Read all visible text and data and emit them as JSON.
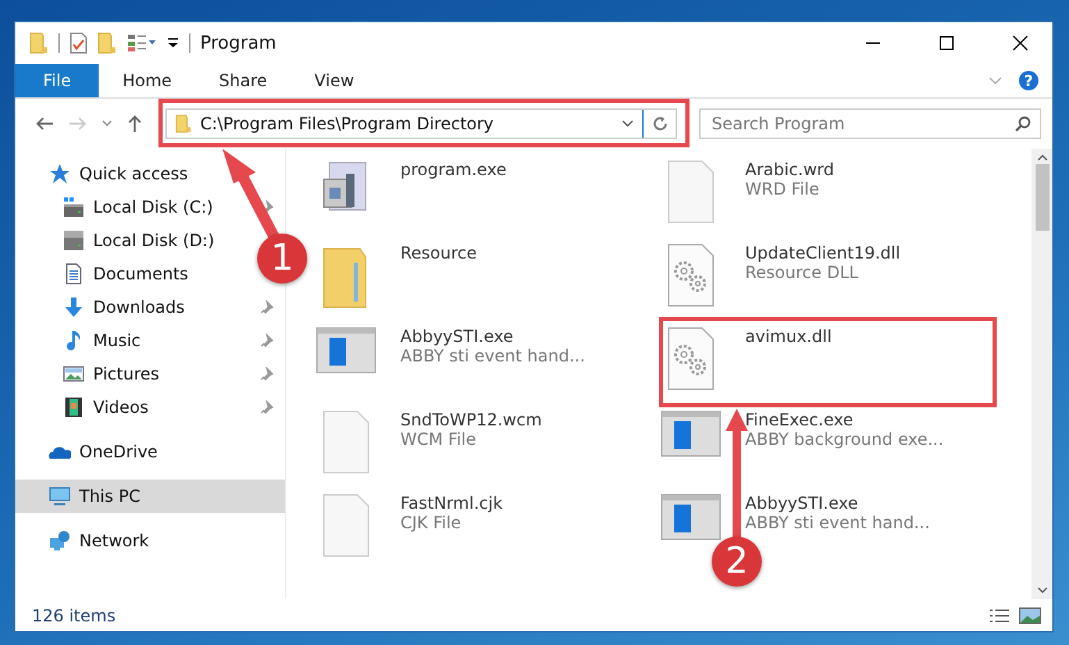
{
  "window": {
    "title": "Program",
    "help": "?"
  },
  "ribbon_tabs": [
    {
      "label": "File",
      "selected": true
    },
    {
      "label": "Home",
      "selected": false
    },
    {
      "label": "Share",
      "selected": false
    },
    {
      "label": "View",
      "selected": false
    }
  ],
  "address": {
    "path": "C:\\Program Files\\Program Directory"
  },
  "search": {
    "placeholder": "Search Program"
  },
  "sidebar": {
    "items": [
      {
        "label": "Quick access",
        "kind": "star",
        "selected": false,
        "children": [
          {
            "label": "Local Disk (C:)",
            "kind": "drive-win",
            "pinned": true,
            "selected": false
          },
          {
            "label": "Local Disk (D:)",
            "kind": "drive",
            "pinned": false,
            "selected": false
          },
          {
            "label": "Documents",
            "kind": "document",
            "pinned": false,
            "selected": false
          },
          {
            "label": "Downloads",
            "kind": "download",
            "pinned": true,
            "selected": false
          },
          {
            "label": "Music",
            "kind": "music",
            "pinned": true,
            "selected": false
          },
          {
            "label": "Pictures",
            "kind": "pictures",
            "pinned": true,
            "selected": false
          },
          {
            "label": "Videos",
            "kind": "videos",
            "pinned": true,
            "selected": false
          }
        ]
      },
      {
        "label": "OneDrive",
        "kind": "cloud",
        "selected": false
      },
      {
        "label": "This PC",
        "kind": "pc",
        "selected": true
      },
      {
        "label": "Network",
        "kind": "network",
        "selected": false
      }
    ]
  },
  "files": [
    {
      "name": "program.exe",
      "kind": "app"
    },
    {
      "name": "Arabic.wrd",
      "type": "WRD File",
      "kind": "blank"
    },
    {
      "name": "Resource",
      "kind": "folder"
    },
    {
      "name": "UpdateClient19.dll",
      "type": "Resource DLL",
      "kind": "dll"
    },
    {
      "name": "AbbyySTI.exe",
      "type": "ABBY sti event hand...",
      "kind": "window"
    },
    {
      "name": "avimux.dll",
      "kind": "dll"
    },
    {
      "name": "SndToWP12.wcm",
      "type": "WCM File",
      "kind": "blank"
    },
    {
      "name": "FineExec.exe",
      "type": "ABBY background exe...",
      "kind": "window"
    },
    {
      "name": "FastNrml.cjk",
      "type": "CJK File",
      "kind": "blank"
    },
    {
      "name": "AbbyySTI.exe",
      "type": "ABBY sti event hand...",
      "kind": "window"
    }
  ],
  "status_bar": {
    "count": "126 items"
  },
  "annotations": [
    {
      "label": "1"
    },
    {
      "label": "2"
    }
  ]
}
